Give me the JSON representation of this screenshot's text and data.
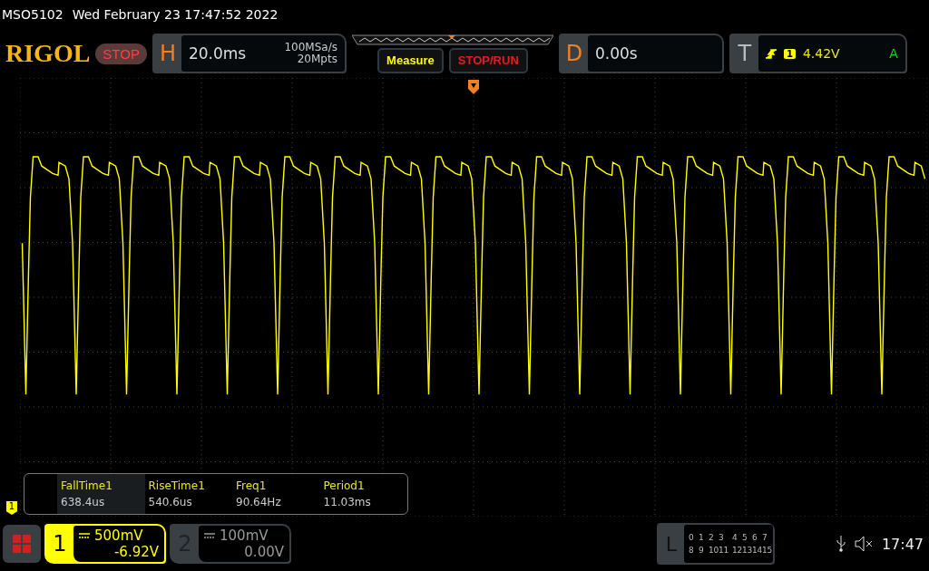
{
  "title_bar": {
    "model": "MSO5102",
    "datetime": "Wed February 23 17:47:52 2022"
  },
  "toolbar": {
    "logo": "RIGOL",
    "run_state": "STOP",
    "horizontal": {
      "label": "H",
      "timebase": "20.0ms",
      "sample_rate": "100MSa/s",
      "memory_depth": "20Mpts"
    },
    "measure_button": "Measure",
    "stop_run_button": "STOP/RUN",
    "delay": {
      "label": "D",
      "value": "0.00s"
    },
    "trigger": {
      "label": "T",
      "source": "1",
      "trigger_level": "4.42V",
      "mode": "A"
    }
  },
  "measurements": [
    {
      "name": "FallTime1",
      "value": "638.4us",
      "selected": true
    },
    {
      "name": "RiseTime1",
      "value": "540.6us",
      "selected": false
    },
    {
      "name": "Freq1",
      "value": "90.64Hz",
      "selected": false
    },
    {
      "name": "Period1",
      "value": "11.03ms",
      "selected": false
    }
  ],
  "channel_marker": "1",
  "channels": [
    {
      "number": "1",
      "scale": "500mV",
      "offset": "-6.92V",
      "active": true
    },
    {
      "number": "2",
      "scale": "100mV",
      "offset": "0.00V",
      "active": false
    }
  ],
  "logic": {
    "label": "L",
    "rows": [
      [
        "0",
        "1",
        "2",
        "3",
        "4",
        "5",
        "6",
        "7"
      ],
      [
        "8",
        "9",
        "10",
        "11",
        "12",
        "13",
        "14",
        "15"
      ]
    ]
  },
  "status": {
    "time": "17:47"
  }
}
